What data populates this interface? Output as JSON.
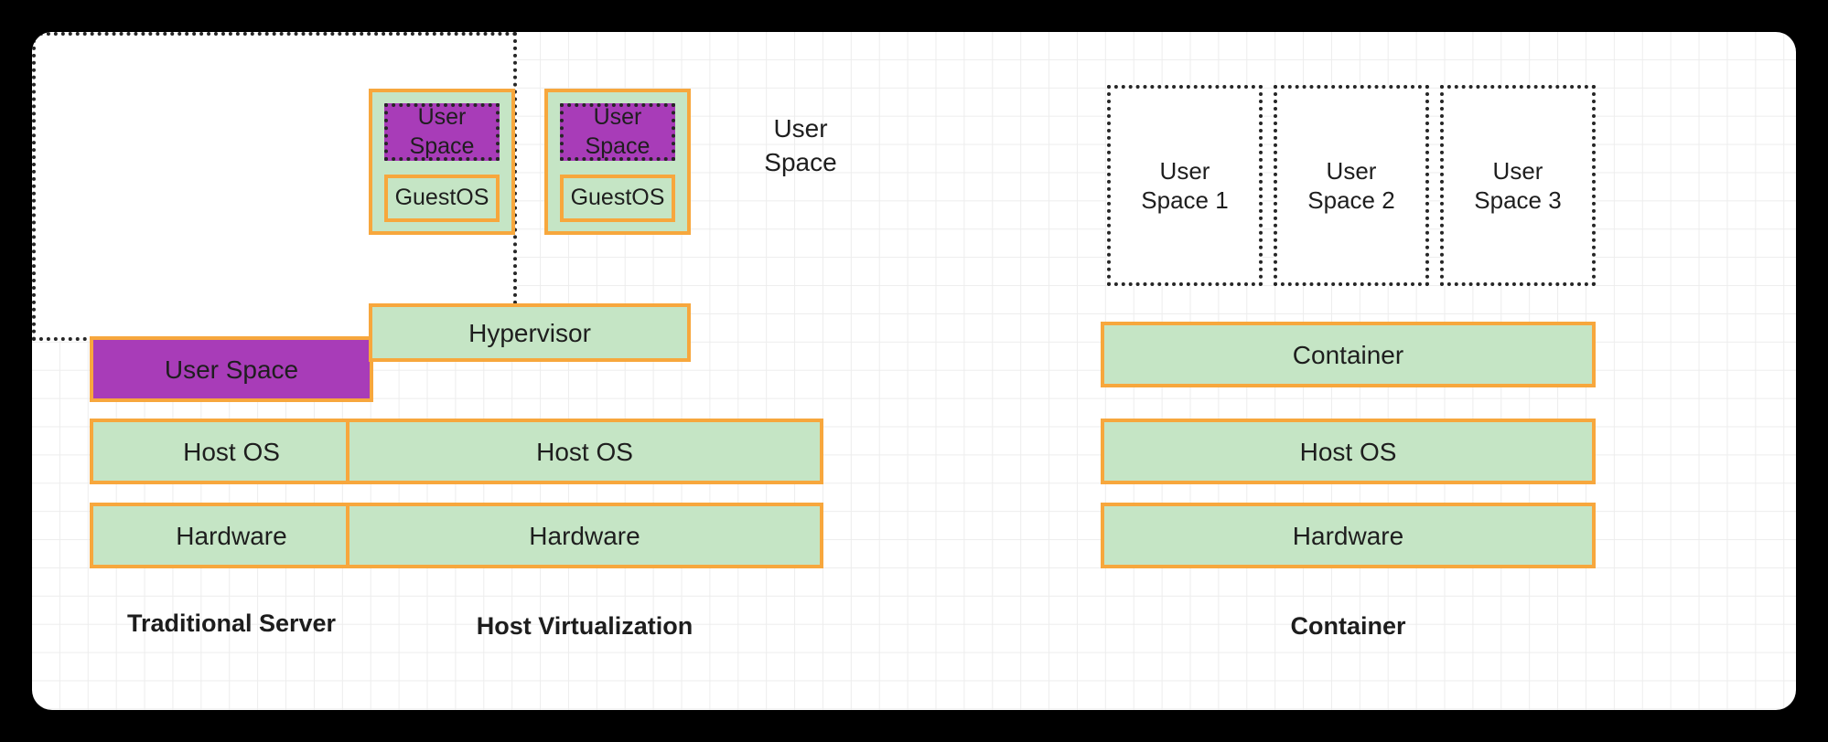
{
  "diagram": {
    "title": "Traditional Server vs Host Virtualization vs Container",
    "colors": {
      "page_background": "#000000",
      "card_background": "#ffffff",
      "grid_line": "#ededed",
      "block_border_orange": "#f7a73d",
      "block_fill_green": "#c5e5c5",
      "block_fill_purple": "#a83cb8",
      "dotted_border": "#262626",
      "text": "#1e1e1e"
    }
  },
  "columns": [
    {
      "id": "traditional-server",
      "caption": "Traditional Server",
      "blocks": [
        {
          "id": "user-space",
          "label": "User Space",
          "style": "purple"
        },
        {
          "id": "host-os",
          "label": "Host OS",
          "style": "green"
        },
        {
          "id": "hardware",
          "label": "Hardware",
          "style": "green"
        }
      ]
    },
    {
      "id": "host-virtualization",
      "caption": "Host Virtualization",
      "group_label": "User\nSpace",
      "vms": [
        {
          "id": "vm-1",
          "user_space_label": "User\nSpace",
          "guest_os_label": "GuestOS"
        },
        {
          "id": "vm-2",
          "user_space_label": "User\nSpace",
          "guest_os_label": "GuestOS"
        }
      ],
      "blocks": [
        {
          "id": "hypervisor",
          "label": "Hypervisor",
          "style": "green"
        },
        {
          "id": "host-os",
          "label": "Host OS",
          "style": "green"
        },
        {
          "id": "hardware",
          "label": "Hardware",
          "style": "green"
        }
      ]
    },
    {
      "id": "container",
      "caption": "Container",
      "user_spaces": [
        {
          "id": "user-space-1",
          "label": "User\nSpace 1"
        },
        {
          "id": "user-space-2",
          "label": "User\nSpace 2"
        },
        {
          "id": "user-space-3",
          "label": "User\nSpace 3"
        }
      ],
      "blocks": [
        {
          "id": "container",
          "label": "Container",
          "style": "green"
        },
        {
          "id": "host-os",
          "label": "Host OS",
          "style": "green"
        },
        {
          "id": "hardware",
          "label": "Hardware",
          "style": "green"
        }
      ]
    }
  ]
}
